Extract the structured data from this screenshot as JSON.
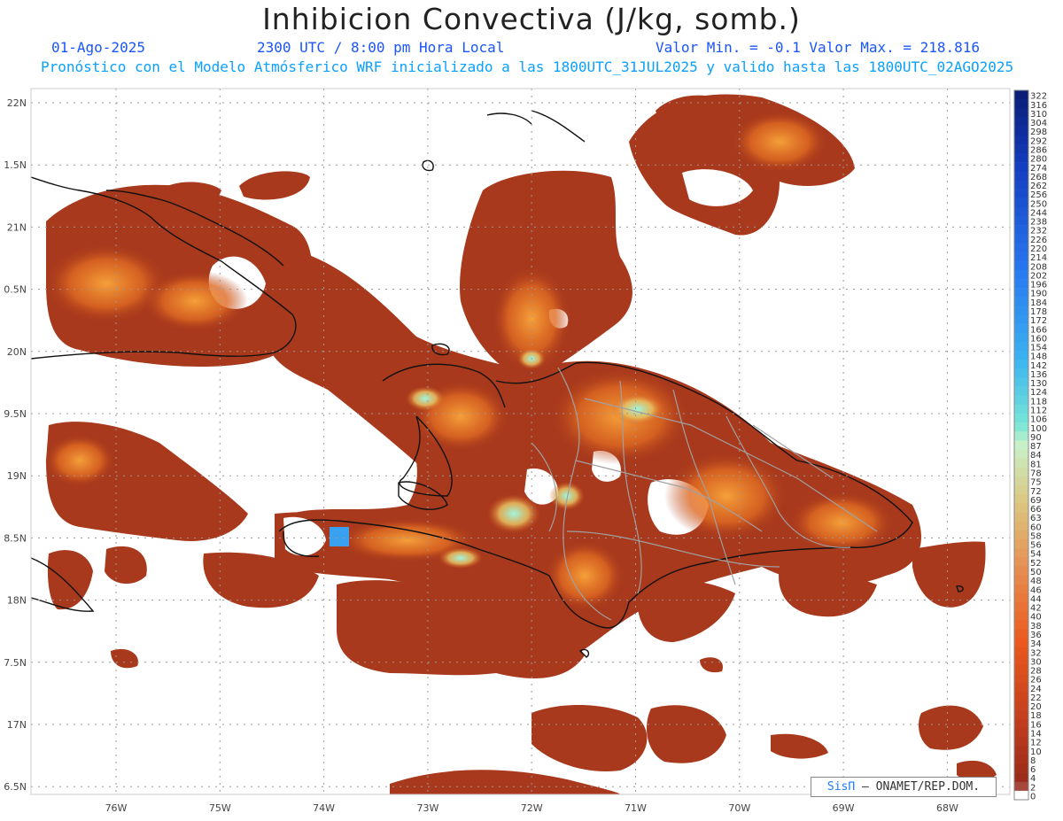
{
  "header": {
    "title": "Inhibicion Convectiva (J/kg, somb.)",
    "date": "01-Ago-2025",
    "time": "2300 UTC / 8:00 pm Hora Local",
    "minmax": "Valor Min. = -0.1  Valor Max. = 218.816",
    "subtitle": "Pronóstico con el Modelo Atmósferico WRF inicializado a las 1800UTC_31JUL2025 y valido hasta las  1800UTC_02AGO2025"
  },
  "axes": {
    "lat_labels": [
      "22N",
      "1.5N",
      "21N",
      "0.5N",
      "20N",
      "9.5N",
      "19N",
      "8.5N",
      "18N",
      "7.5N",
      "17N",
      "6.5N"
    ],
    "lon_labels": [
      "76W",
      "75W",
      "74W",
      "73W",
      "72W",
      "71W",
      "70W",
      "69W",
      "68W"
    ]
  },
  "colorbar": {
    "labels": [
      "322",
      "316",
      "310",
      "304",
      "298",
      "292",
      "286",
      "280",
      "274",
      "268",
      "262",
      "256",
      "250",
      "244",
      "238",
      "232",
      "226",
      "220",
      "214",
      "208",
      "202",
      "196",
      "190",
      "184",
      "178",
      "172",
      "166",
      "160",
      "154",
      "148",
      "142",
      "136",
      "130",
      "124",
      "118",
      "112",
      "106",
      "100",
      "90",
      "87",
      "84",
      "81",
      "78",
      "75",
      "72",
      "69",
      "66",
      "63",
      "60",
      "58",
      "56",
      "54",
      "52",
      "50",
      "48",
      "46",
      "44",
      "42",
      "40",
      "38",
      "36",
      "34",
      "32",
      "30",
      "28",
      "26",
      "24",
      "22",
      "20",
      "18",
      "16",
      "14",
      "12",
      "10",
      "8",
      "6",
      "4",
      "2",
      "0"
    ]
  },
  "credit": {
    "sis": "SisΠ",
    "text": "– ONAMET/REP.DOM."
  },
  "colors": {
    "field_base": "#a8391c",
    "field_warm": "#d5571e",
    "field_hot": "#f08a2a",
    "field_cyan": "#8ef0d8",
    "coast": "#111111",
    "province": "#a0a0a0"
  }
}
